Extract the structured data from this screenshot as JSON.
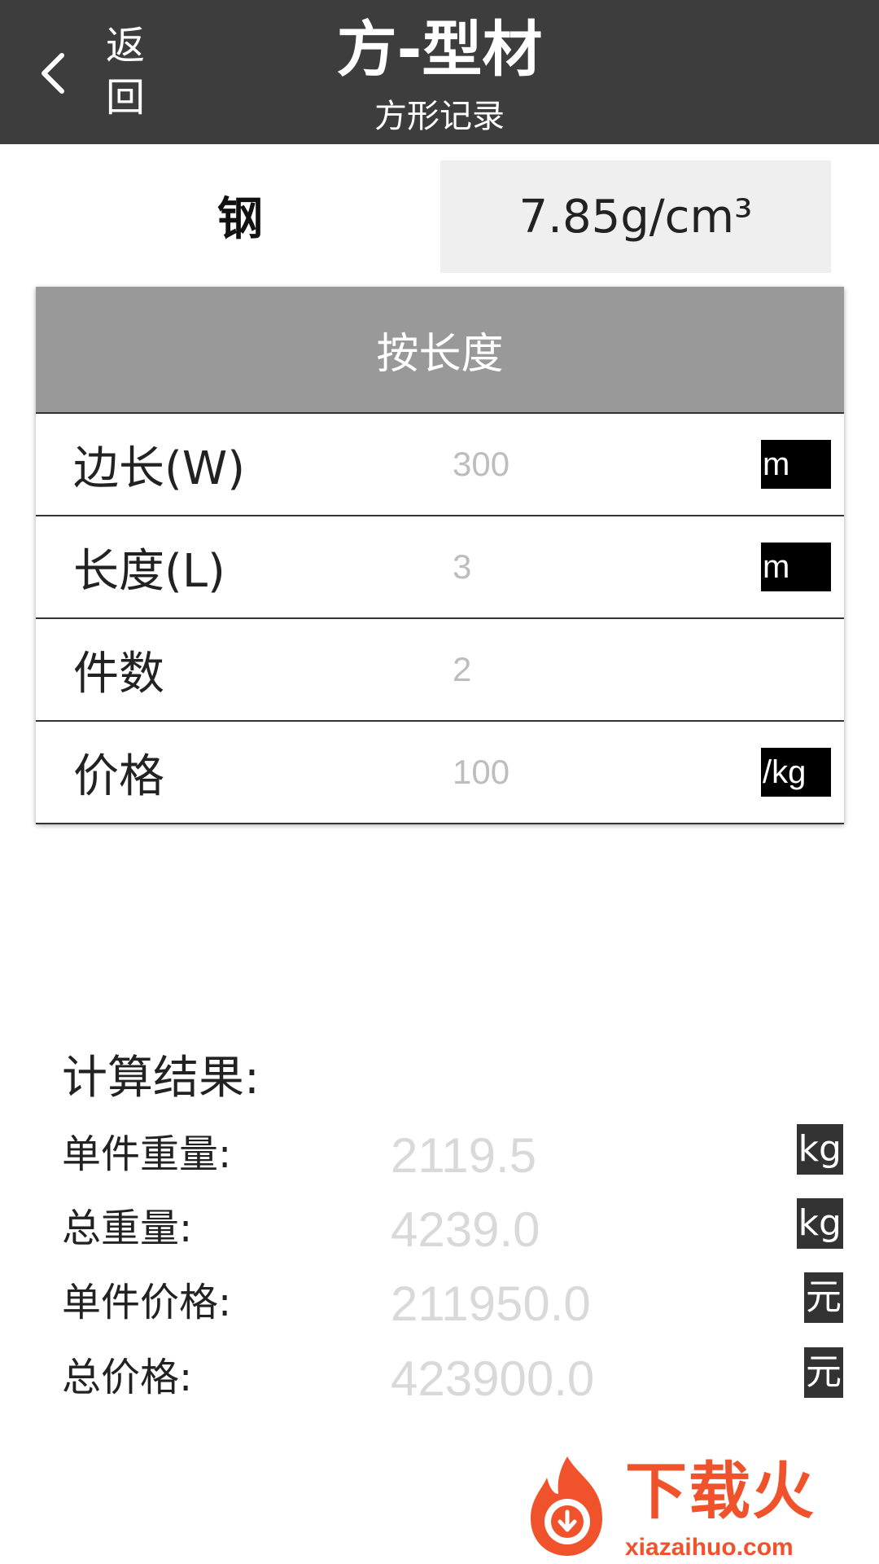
{
  "header": {
    "back_label": "返回",
    "title": "方-型材",
    "subtitle": "方形记录"
  },
  "material": {
    "name": "钢",
    "density": "7.85g/cm³"
  },
  "form": {
    "tab_label": "按长度",
    "rows": [
      {
        "label": "边长(W)",
        "value": "300",
        "unit": "m"
      },
      {
        "label": "长度(L)",
        "value": "3",
        "unit": "m"
      },
      {
        "label": "件数",
        "value": "2",
        "unit": ""
      },
      {
        "label": "价格",
        "value": "100",
        "unit": "/kg"
      }
    ]
  },
  "results": {
    "title": "计算结果:",
    "rows": [
      {
        "label": "单件重量:",
        "value": "2119.5",
        "unit": "kg"
      },
      {
        "label": "总重量:",
        "value": "4239.0",
        "unit": "kg"
      },
      {
        "label": "单件价格:",
        "value": "211950.0",
        "unit": "元"
      },
      {
        "label": "总价格:",
        "value": "423900.0",
        "unit": "元"
      }
    ]
  },
  "watermark": {
    "text": "下载火",
    "url": "xiazaihuo.com",
    "color": "#f0522b"
  },
  "colors": {
    "header_bg": "#3d3d3d",
    "tab_bg": "#999999",
    "density_bg": "#efefef"
  }
}
